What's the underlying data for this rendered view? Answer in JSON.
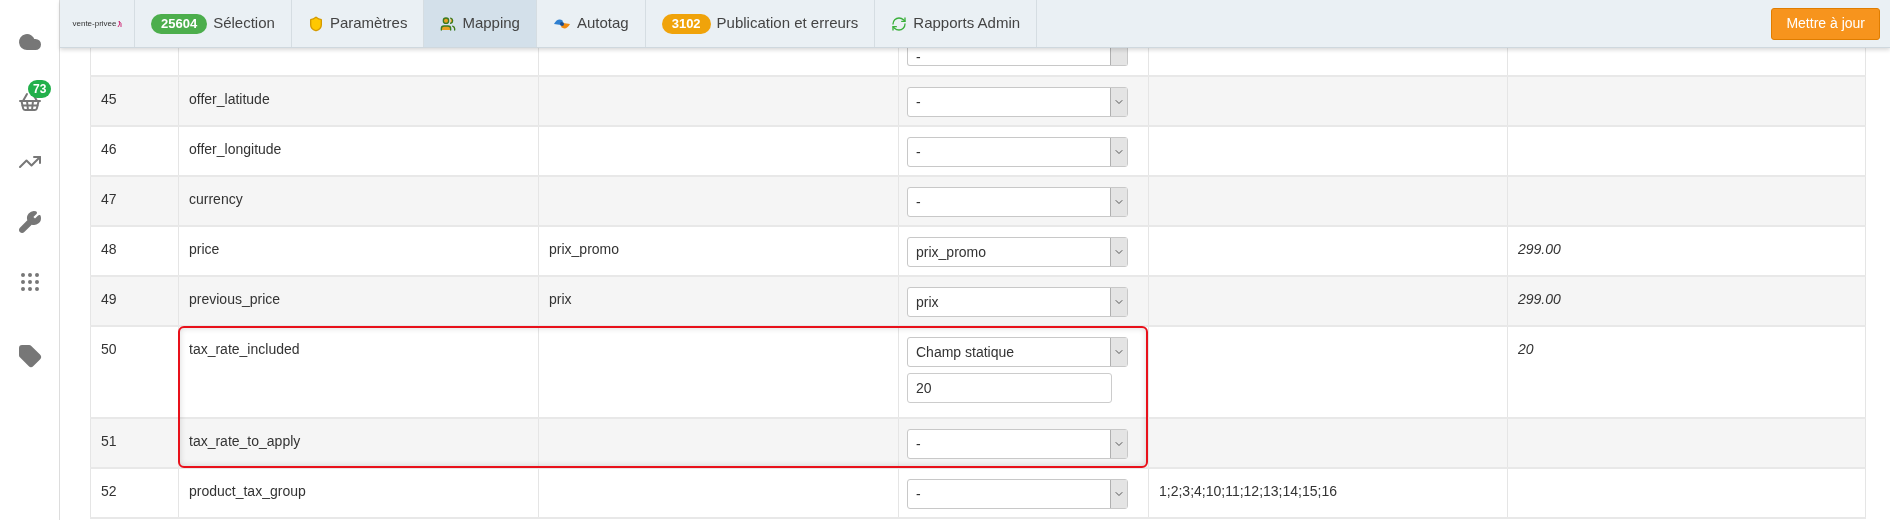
{
  "sidebar": {
    "items": [
      {
        "kind": "cloud"
      },
      {
        "kind": "basket",
        "badge": "73"
      },
      {
        "kind": "trend"
      },
      {
        "kind": "wrench"
      },
      {
        "kind": "grid"
      },
      {
        "kind": "tag"
      }
    ]
  },
  "nav": {
    "logo": "vente-privee",
    "tabs": [
      {
        "kind": "selection",
        "label": "Sélection",
        "badge": "25604",
        "color": "#4cae4c",
        "selected": false
      },
      {
        "kind": "shield",
        "label": "Paramètres",
        "selected": false
      },
      {
        "kind": "people",
        "label": "Mapping",
        "selected": true
      },
      {
        "kind": "autotag",
        "label": "Autotag",
        "selected": false
      },
      {
        "kind": "publication",
        "label": "Publication et erreurs",
        "badge": "3102",
        "color": "#f0a30a",
        "selected": false
      },
      {
        "kind": "refresh",
        "label": "Rapports Admin",
        "selected": false
      }
    ],
    "update_button": "Mettre à jour"
  },
  "table": {
    "rows": [
      {
        "kind": "cut",
        "select": "-"
      },
      {
        "number": "45",
        "field": "offer_latitude",
        "source": "",
        "select": "-",
        "value_5": "",
        "value_6": ""
      },
      {
        "number": "46",
        "field": "offer_longitude",
        "source": "",
        "select": "-",
        "value_5": "",
        "value_6": ""
      },
      {
        "number": "47",
        "field": "currency",
        "source": "",
        "select": "-",
        "value_5": "",
        "value_6": ""
      },
      {
        "number": "48",
        "field": "price",
        "source": "prix_promo",
        "select": "prix_promo",
        "value_5": "",
        "value_6": "299.00"
      },
      {
        "number": "49",
        "field": "previous_price",
        "source": "prix",
        "select": "prix",
        "value_5": "",
        "value_6": "299.00"
      },
      {
        "number": "50",
        "field": "tax_rate_included",
        "source": "",
        "select": "Champ statique",
        "static_value": "20",
        "value_5": "",
        "value_6": "20",
        "highlighted": true
      },
      {
        "number": "51",
        "field": "tax_rate_to_apply",
        "source": "",
        "select": "-",
        "value_5": "",
        "value_6": "",
        "highlighted": true
      },
      {
        "number": "52",
        "field": "product_tax_group",
        "source": "",
        "select": "-",
        "value_5": "1;2;3;4;10;11;12;13;14;15;16",
        "value_6": ""
      }
    ]
  }
}
